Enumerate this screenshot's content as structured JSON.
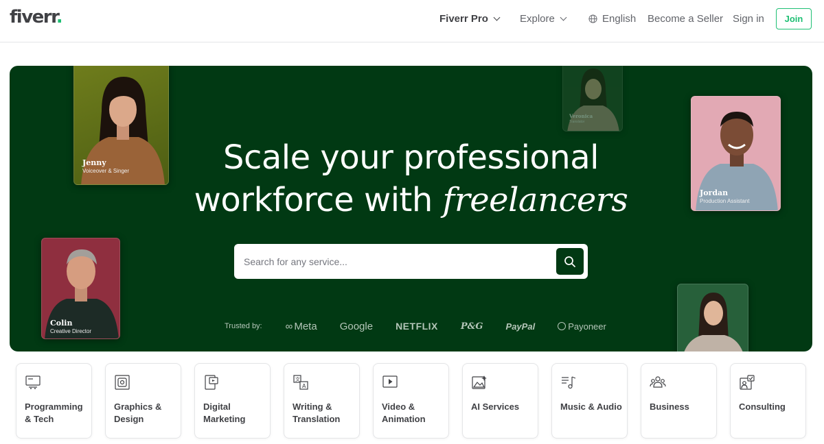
{
  "header": {
    "logo": "fiverr",
    "logo_dot": ".",
    "nav": {
      "pro": "Fiverr Pro",
      "explore": "Explore",
      "language": "English",
      "become_seller": "Become a Seller",
      "sign_in": "Sign in",
      "join": "Join"
    }
  },
  "hero": {
    "headline_line1": "Scale your professional",
    "headline_line2_prefix": "workforce with ",
    "headline_line2_italic": "freelancers",
    "search": {
      "placeholder": "Search for any service..."
    },
    "trusted_label": "Trusted by:",
    "brands": [
      "Meta",
      "Google",
      "NETFLIX",
      "P&G",
      "PayPal",
      "Payoneer"
    ],
    "profiles": [
      {
        "name": "Jenny",
        "role": "Voiceover & Singer"
      },
      {
        "name": "Veronica",
        "role": "Translator"
      },
      {
        "name": "Jordan",
        "role": "Production Assistant"
      },
      {
        "name": "Colin",
        "role": "Creative Director"
      }
    ]
  },
  "categories": [
    {
      "line1": "Programming",
      "line2": "& Tech",
      "icon": "programming-icon"
    },
    {
      "line1": "Graphics &",
      "line2": "Design",
      "icon": "graphics-icon"
    },
    {
      "line1": "Digital",
      "line2": "Marketing",
      "icon": "marketing-icon"
    },
    {
      "line1": "Writing &",
      "line2": "Translation",
      "icon": "writing-icon"
    },
    {
      "line1": "Video &",
      "line2": "Animation",
      "icon": "video-icon"
    },
    {
      "line1": "AI Services",
      "line2": "",
      "icon": "ai-icon"
    },
    {
      "line1": "Music & Audio",
      "line2": "",
      "icon": "music-icon"
    },
    {
      "line1": "Business",
      "line2": "",
      "icon": "business-icon"
    },
    {
      "line1": "Consulting",
      "line2": "",
      "icon": "consulting-icon"
    }
  ],
  "colors": {
    "brand_green": "#1dbf73",
    "hero_bg": "#013913",
    "text": "#404145"
  }
}
